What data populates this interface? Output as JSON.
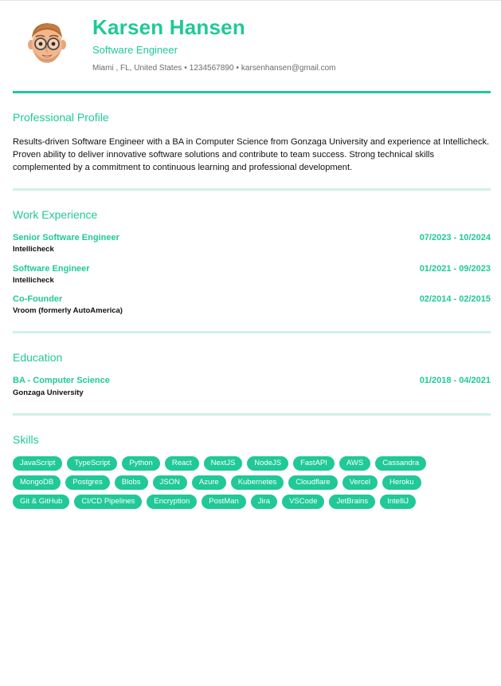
{
  "header": {
    "name": "Karsen Hansen",
    "title": "Software Engineer",
    "location": "Miami , FL, United States",
    "phone": "1234567890",
    "email": "karsenhansen@gmail.com",
    "separator": "•"
  },
  "profile": {
    "heading": "Professional Profile",
    "text": "Results-driven Software Engineer with a BA in Computer Science from Gonzaga University and experience at Intellicheck. Proven ability to deliver innovative software solutions and contribute to team success. Strong technical skills complemented by a commitment to continuous learning and professional development."
  },
  "work": {
    "heading": "Work Experience",
    "items": [
      {
        "title": "Senior Software Engineer",
        "company": "Intellicheck",
        "dates": "07/2023 - 10/2024"
      },
      {
        "title": "Software Engineer",
        "company": "Intellicheck",
        "dates": "01/2021 - 09/2023"
      },
      {
        "title": "Co-Founder",
        "company": "Vroom (formerly AutoAmerica)",
        "dates": "02/2014 - 02/2015"
      }
    ]
  },
  "education": {
    "heading": "Education",
    "items": [
      {
        "title": "BA - Computer Science",
        "school": "Gonzaga University",
        "dates": "01/2018 - 04/2021"
      }
    ]
  },
  "skills": {
    "heading": "Skills",
    "rows": [
      [
        "JavaScript",
        "TypeScript",
        "Python",
        "React",
        "NextJS",
        "NodeJS",
        "FastAPI",
        "AWS",
        "Cassandra"
      ],
      [
        "MongoDB",
        "Postgres",
        "Blobs",
        "JSON",
        "Azure",
        "Kubernetes",
        "Cloudflare",
        "Vercel",
        "Heroku"
      ],
      [
        "Git & GitHub",
        "CI/CD Pipelines",
        "Encryption",
        "PostMan",
        "Jira",
        "VSCode",
        "JetBrains",
        "IntelliJ"
      ]
    ]
  },
  "colors": {
    "accent": "#20c997",
    "divider": "#cdf3e6",
    "text": "#111111",
    "muted": "#6b6b6b"
  },
  "icons": {
    "avatar": "memoji-avatar-icon"
  }
}
